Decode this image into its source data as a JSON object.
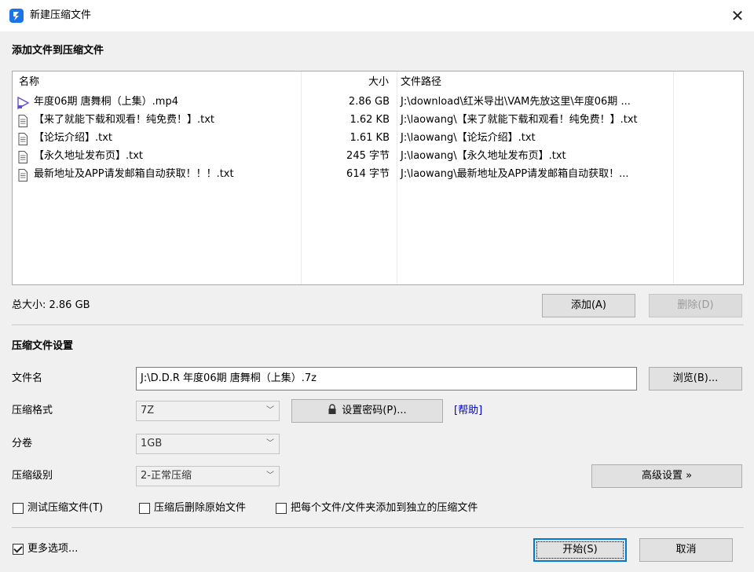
{
  "window": {
    "title": "新建压缩文件",
    "close_glyph": "✕"
  },
  "add_section": {
    "title": "添加文件到压缩文件"
  },
  "file_list": {
    "columns": {
      "name": "名称",
      "size": "大小",
      "path": "文件路径"
    },
    "rows": [
      {
        "name": "年度06期 唐舞桐（上集）.mp4",
        "size": "2.86 GB",
        "path": "J:\\download\\红米导出\\VAM先放这里\\年度06期 ...",
        "icon": "video-file-icon"
      },
      {
        "name": "【来了就能下载和观看！纯免费！】.txt",
        "size": "1.62 KB",
        "path": "J:\\laowang\\【来了就能下载和观看！纯免费！】.txt",
        "icon": "text-file-icon"
      },
      {
        "name": "【论坛介绍】.txt",
        "size": "1.61 KB",
        "path": "J:\\laowang\\【论坛介绍】.txt",
        "icon": "text-file-icon"
      },
      {
        "name": "【永久地址发布页】.txt",
        "size": "245 字节",
        "path": "J:\\laowang\\【永久地址发布页】.txt",
        "icon": "text-file-icon"
      },
      {
        "name": "最新地址及APP请发邮箱自动获取！！！.txt",
        "size": "614 字节",
        "path": "J:\\laowang\\最新地址及APP请发邮箱自动获取！...",
        "icon": "text-file-icon"
      }
    ]
  },
  "total_size": "总大小: 2.86 GB",
  "buttons": {
    "add": "添加(A)",
    "delete": "删除(D)",
    "browse": "浏览(B)...",
    "set_password": "设置密码(P)...",
    "advanced": "高级设置 »",
    "start": "开始(S)",
    "cancel": "取消"
  },
  "settings": {
    "title": "压缩文件设置",
    "filename_label": "文件名",
    "filename_value": "J:\\D.D.R 年度06期 唐舞桐（上集）.7z",
    "format_label": "压缩格式",
    "format_value": "7Z",
    "help_link": "[帮助]",
    "volume_label": "分卷",
    "volume_value": "1GB",
    "level_label": "压缩级别",
    "level_value": "2-正常压缩"
  },
  "options": {
    "test": {
      "label": "测试压缩文件(T)",
      "checked": false
    },
    "delete_after": {
      "label": "压缩后删除原始文件",
      "checked": false
    },
    "separate": {
      "label": "把每个文件/文件夹添加到独立的压缩文件",
      "checked": false
    },
    "more": {
      "label": "更多选项...",
      "checked": true
    }
  },
  "colors": {
    "accent": "#0078d7",
    "app_icon": "#1a73e8",
    "link": "#0000cc"
  }
}
